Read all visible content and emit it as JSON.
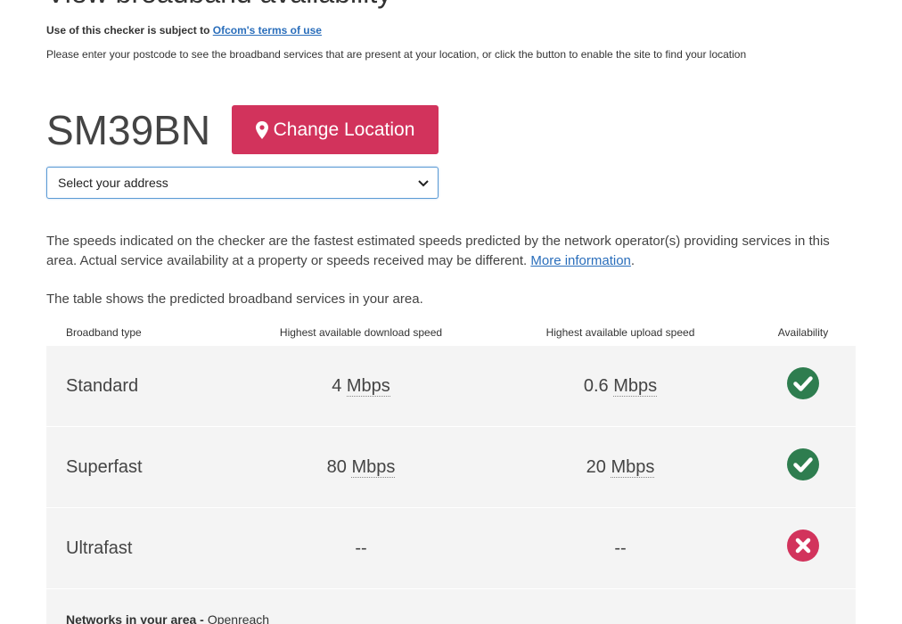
{
  "header": {
    "title": "View broadband availability",
    "terms_prefix": "Use of this checker is subject to",
    "terms_link": "Ofcom's terms of use",
    "instruction": "Please enter your postcode to see the broadband services that are present at your location, or click the button to enable the site to find your location"
  },
  "location": {
    "postcode": "SM39BN",
    "change_button_label": "Change Location",
    "change_button_icon": "map-marker-icon",
    "address_select_value": "Select your address"
  },
  "info": {
    "speed_note": "The speeds indicated on the checker are the fastest estimated speeds predicted by the network operator(s) providing services in this area. Actual service availability at a property or speeds received may be different.",
    "more_info_link": "More information",
    "more_info_suffix": ".",
    "table_intro": "The table shows the predicted broadband services in your area."
  },
  "table": {
    "headers": {
      "type": "Broadband type",
      "download": "Highest available download speed",
      "upload": "Highest available upload speed",
      "availability": "Availability"
    },
    "rows": [
      {
        "type": "Standard",
        "download_value": "4",
        "download_unit": "Mbps",
        "upload_value": "0.6",
        "upload_unit": "Mbps",
        "available": true,
        "download_text": "",
        "upload_text": ""
      },
      {
        "type": "Superfast",
        "download_value": "80",
        "download_unit": "Mbps",
        "upload_value": "20",
        "upload_unit": "Mbps",
        "available": true,
        "download_text": "",
        "upload_text": ""
      },
      {
        "type": "Ultrafast",
        "download_value": "",
        "download_unit": "",
        "upload_value": "",
        "upload_unit": "",
        "available": false,
        "download_text": "--",
        "upload_text": "--"
      }
    ],
    "networks_label": "Networks in your area -",
    "networks_value": "Openreach"
  },
  "colors": {
    "accent_button": "#d2335c",
    "available_green": "#2e7d4f",
    "unavailable_red": "#d2335c",
    "link_blue": "#2a6ebb",
    "row_bg": "#f4f4f4"
  }
}
